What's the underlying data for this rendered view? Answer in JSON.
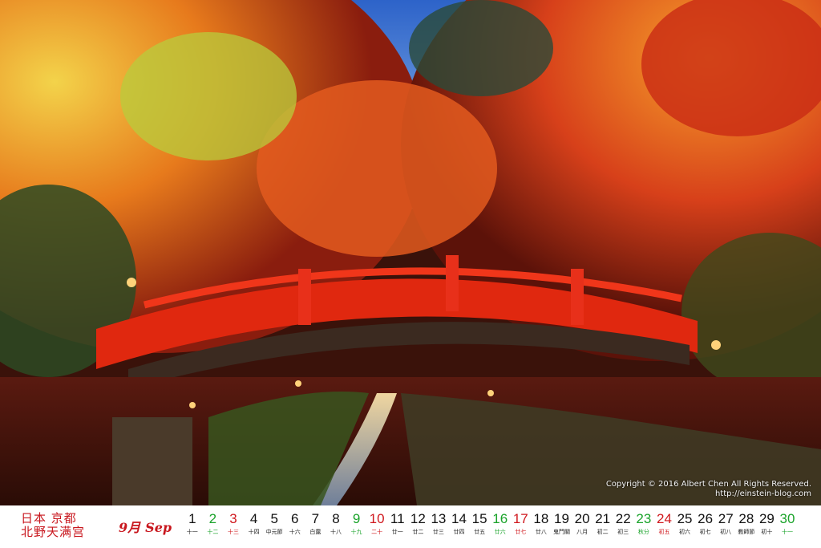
{
  "photo": {
    "alt_icon": "kyoto-bridge-photo-icon",
    "copyright_line1": "Copyright © 2016 Albert Chen All Rights Reserved.",
    "copyright_line2": "http://einstein-blog.com"
  },
  "calendar": {
    "location_line1": "日本 京都",
    "location_line2": "北野天满宫",
    "month_cn": "9月",
    "month_en": "Sep",
    "colors": {
      "holiday_red": "#d0181e",
      "saturday_green": "#1aa32a",
      "text": "#111111"
    },
    "days": [
      {
        "n": "1",
        "l": "十一",
        "t": "w"
      },
      {
        "n": "2",
        "l": "十二",
        "t": "sat"
      },
      {
        "n": "3",
        "l": "十三",
        "t": "sun"
      },
      {
        "n": "4",
        "l": "十四",
        "t": "w"
      },
      {
        "n": "5",
        "l": "中元節",
        "t": "w"
      },
      {
        "n": "6",
        "l": "十六",
        "t": "w"
      },
      {
        "n": "7",
        "l": "白露",
        "t": "w"
      },
      {
        "n": "8",
        "l": "十八",
        "t": "w"
      },
      {
        "n": "9",
        "l": "十九",
        "t": "sat"
      },
      {
        "n": "10",
        "l": "二十",
        "t": "sun"
      },
      {
        "n": "11",
        "l": "廿一",
        "t": "w"
      },
      {
        "n": "12",
        "l": "廿二",
        "t": "w"
      },
      {
        "n": "13",
        "l": "廿三",
        "t": "w"
      },
      {
        "n": "14",
        "l": "廿四",
        "t": "w"
      },
      {
        "n": "15",
        "l": "廿五",
        "t": "w"
      },
      {
        "n": "16",
        "l": "廿六",
        "t": "sat"
      },
      {
        "n": "17",
        "l": "廿七",
        "t": "sun"
      },
      {
        "n": "18",
        "l": "廿八",
        "t": "w"
      },
      {
        "n": "19",
        "l": "鬼門關",
        "t": "w"
      },
      {
        "n": "20",
        "l": "八月",
        "t": "w"
      },
      {
        "n": "21",
        "l": "初二",
        "t": "w"
      },
      {
        "n": "22",
        "l": "初三",
        "t": "w"
      },
      {
        "n": "23",
        "l": "秋分",
        "t": "sat"
      },
      {
        "n": "24",
        "l": "初五",
        "t": "sun"
      },
      {
        "n": "25",
        "l": "初六",
        "t": "w"
      },
      {
        "n": "26",
        "l": "初七",
        "t": "w"
      },
      {
        "n": "27",
        "l": "初八",
        "t": "w"
      },
      {
        "n": "28",
        "l": "教師節",
        "t": "w"
      },
      {
        "n": "29",
        "l": "初十",
        "t": "w"
      },
      {
        "n": "30",
        "l": "十一",
        "t": "sat"
      }
    ]
  }
}
